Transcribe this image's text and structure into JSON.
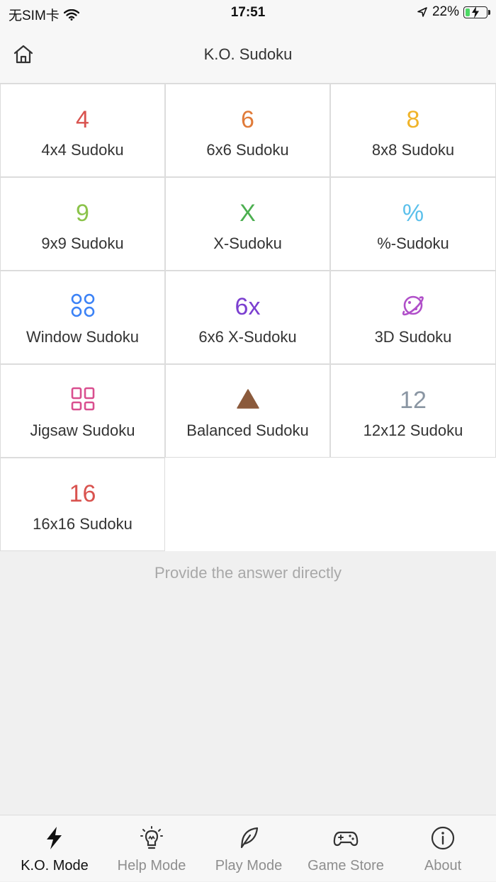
{
  "status": {
    "carrier": "无SIM卡",
    "time": "17:51",
    "battery_text": "22%",
    "battery_level": 0.22
  },
  "nav": {
    "title": "K.O. Sudoku",
    "home_icon": "home-icon"
  },
  "games": [
    {
      "glyph": "4",
      "label": "4x4 Sudoku",
      "color": "#d9534f"
    },
    {
      "glyph": "6",
      "label": "6x6 Sudoku",
      "color": "#e07b39"
    },
    {
      "glyph": "8",
      "label": "8x8 Sudoku",
      "color": "#f0b429"
    },
    {
      "glyph": "9",
      "label": "9x9 Sudoku",
      "color": "#8bc34a"
    },
    {
      "glyph": "X",
      "label": "X-Sudoku",
      "color": "#4caf50"
    },
    {
      "glyph": "%",
      "label": "%-Sudoku",
      "color": "#5bc0eb"
    },
    {
      "glyph": "",
      "icon": "window-grid-icon",
      "label": "Window Sudoku",
      "color": "#3b82f6"
    },
    {
      "glyph": "6x",
      "label": "6x6 X-Sudoku",
      "color": "#7b3fd0"
    },
    {
      "glyph": "",
      "icon": "planet-icon",
      "label": "3D Sudoku",
      "color": "#b04fc9"
    },
    {
      "glyph": "",
      "icon": "jigsaw-grid-icon",
      "label": "Jigsaw Sudoku",
      "color": "#d94f8f"
    },
    {
      "glyph": "",
      "icon": "triangle-icon",
      "label": "Balanced Sudoku",
      "color": "#8b5a3c"
    },
    {
      "glyph": "12",
      "label": "12x12 Sudoku",
      "color": "#8a96a3"
    },
    {
      "glyph": "16",
      "label": "16x16 Sudoku",
      "color": "#d9534f"
    }
  ],
  "hint": "Provide the answer directly",
  "tabs": [
    {
      "label": "K.O. Mode",
      "icon": "lightning-icon",
      "active": true
    },
    {
      "label": "Help Mode",
      "icon": "lightbulb-icon",
      "active": false
    },
    {
      "label": "Play Mode",
      "icon": "feather-icon",
      "active": false
    },
    {
      "label": "Game Store",
      "icon": "gamepad-icon",
      "active": false
    },
    {
      "label": "About",
      "icon": "info-icon",
      "active": false
    }
  ]
}
